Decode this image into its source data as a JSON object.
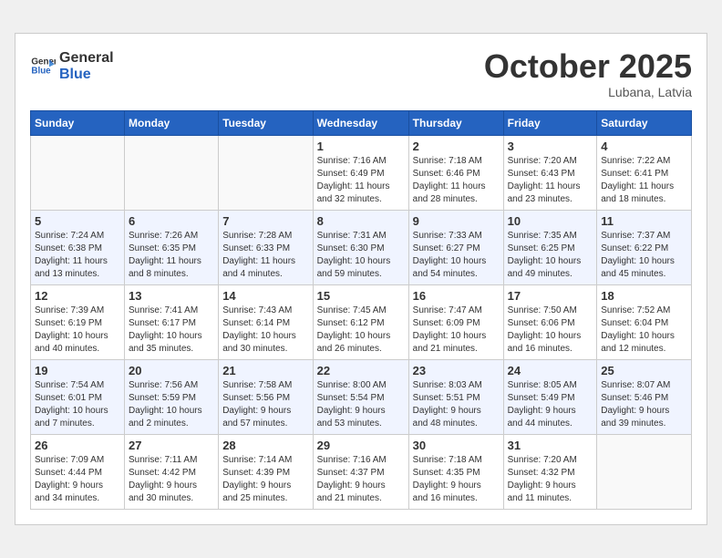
{
  "header": {
    "logo_line1": "General",
    "logo_line2": "Blue",
    "month": "October 2025",
    "location": "Lubana, Latvia"
  },
  "weekdays": [
    "Sunday",
    "Monday",
    "Tuesday",
    "Wednesday",
    "Thursday",
    "Friday",
    "Saturday"
  ],
  "weeks": [
    [
      {
        "day": "",
        "info": ""
      },
      {
        "day": "",
        "info": ""
      },
      {
        "day": "",
        "info": ""
      },
      {
        "day": "1",
        "info": "Sunrise: 7:16 AM\nSunset: 6:49 PM\nDaylight: 11 hours\nand 32 minutes."
      },
      {
        "day": "2",
        "info": "Sunrise: 7:18 AM\nSunset: 6:46 PM\nDaylight: 11 hours\nand 28 minutes."
      },
      {
        "day": "3",
        "info": "Sunrise: 7:20 AM\nSunset: 6:43 PM\nDaylight: 11 hours\nand 23 minutes."
      },
      {
        "day": "4",
        "info": "Sunrise: 7:22 AM\nSunset: 6:41 PM\nDaylight: 11 hours\nand 18 minutes."
      }
    ],
    [
      {
        "day": "5",
        "info": "Sunrise: 7:24 AM\nSunset: 6:38 PM\nDaylight: 11 hours\nand 13 minutes."
      },
      {
        "day": "6",
        "info": "Sunrise: 7:26 AM\nSunset: 6:35 PM\nDaylight: 11 hours\nand 8 minutes."
      },
      {
        "day": "7",
        "info": "Sunrise: 7:28 AM\nSunset: 6:33 PM\nDaylight: 11 hours\nand 4 minutes."
      },
      {
        "day": "8",
        "info": "Sunrise: 7:31 AM\nSunset: 6:30 PM\nDaylight: 10 hours\nand 59 minutes."
      },
      {
        "day": "9",
        "info": "Sunrise: 7:33 AM\nSunset: 6:27 PM\nDaylight: 10 hours\nand 54 minutes."
      },
      {
        "day": "10",
        "info": "Sunrise: 7:35 AM\nSunset: 6:25 PM\nDaylight: 10 hours\nand 49 minutes."
      },
      {
        "day": "11",
        "info": "Sunrise: 7:37 AM\nSunset: 6:22 PM\nDaylight: 10 hours\nand 45 minutes."
      }
    ],
    [
      {
        "day": "12",
        "info": "Sunrise: 7:39 AM\nSunset: 6:19 PM\nDaylight: 10 hours\nand 40 minutes."
      },
      {
        "day": "13",
        "info": "Sunrise: 7:41 AM\nSunset: 6:17 PM\nDaylight: 10 hours\nand 35 minutes."
      },
      {
        "day": "14",
        "info": "Sunrise: 7:43 AM\nSunset: 6:14 PM\nDaylight: 10 hours\nand 30 minutes."
      },
      {
        "day": "15",
        "info": "Sunrise: 7:45 AM\nSunset: 6:12 PM\nDaylight: 10 hours\nand 26 minutes."
      },
      {
        "day": "16",
        "info": "Sunrise: 7:47 AM\nSunset: 6:09 PM\nDaylight: 10 hours\nand 21 minutes."
      },
      {
        "day": "17",
        "info": "Sunrise: 7:50 AM\nSunset: 6:06 PM\nDaylight: 10 hours\nand 16 minutes."
      },
      {
        "day": "18",
        "info": "Sunrise: 7:52 AM\nSunset: 6:04 PM\nDaylight: 10 hours\nand 12 minutes."
      }
    ],
    [
      {
        "day": "19",
        "info": "Sunrise: 7:54 AM\nSunset: 6:01 PM\nDaylight: 10 hours\nand 7 minutes."
      },
      {
        "day": "20",
        "info": "Sunrise: 7:56 AM\nSunset: 5:59 PM\nDaylight: 10 hours\nand 2 minutes."
      },
      {
        "day": "21",
        "info": "Sunrise: 7:58 AM\nSunset: 5:56 PM\nDaylight: 9 hours\nand 57 minutes."
      },
      {
        "day": "22",
        "info": "Sunrise: 8:00 AM\nSunset: 5:54 PM\nDaylight: 9 hours\nand 53 minutes."
      },
      {
        "day": "23",
        "info": "Sunrise: 8:03 AM\nSunset: 5:51 PM\nDaylight: 9 hours\nand 48 minutes."
      },
      {
        "day": "24",
        "info": "Sunrise: 8:05 AM\nSunset: 5:49 PM\nDaylight: 9 hours\nand 44 minutes."
      },
      {
        "day": "25",
        "info": "Sunrise: 8:07 AM\nSunset: 5:46 PM\nDaylight: 9 hours\nand 39 minutes."
      }
    ],
    [
      {
        "day": "26",
        "info": "Sunrise: 7:09 AM\nSunset: 4:44 PM\nDaylight: 9 hours\nand 34 minutes."
      },
      {
        "day": "27",
        "info": "Sunrise: 7:11 AM\nSunset: 4:42 PM\nDaylight: 9 hours\nand 30 minutes."
      },
      {
        "day": "28",
        "info": "Sunrise: 7:14 AM\nSunset: 4:39 PM\nDaylight: 9 hours\nand 25 minutes."
      },
      {
        "day": "29",
        "info": "Sunrise: 7:16 AM\nSunset: 4:37 PM\nDaylight: 9 hours\nand 21 minutes."
      },
      {
        "day": "30",
        "info": "Sunrise: 7:18 AM\nSunset: 4:35 PM\nDaylight: 9 hours\nand 16 minutes."
      },
      {
        "day": "31",
        "info": "Sunrise: 7:20 AM\nSunset: 4:32 PM\nDaylight: 9 hours\nand 11 minutes."
      },
      {
        "day": "",
        "info": ""
      }
    ]
  ]
}
